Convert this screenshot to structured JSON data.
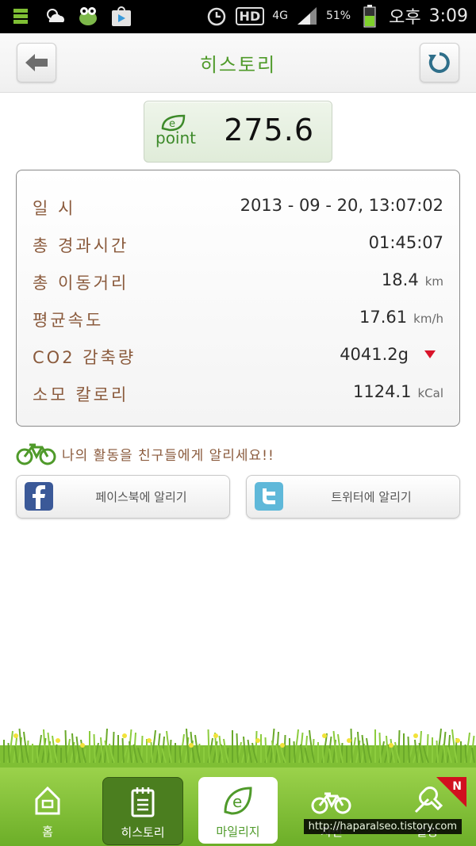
{
  "status_bar": {
    "battery_pct": "51%",
    "network": "4G",
    "hd": "HD",
    "ampm": "오후",
    "time": "3:09"
  },
  "header": {
    "title": "히스토리"
  },
  "epoint": {
    "logo_text": "point",
    "value": "275.6"
  },
  "details": [
    {
      "label": "일 시",
      "value": "2013 - 09 - 20, 13:07:02",
      "unit": ""
    },
    {
      "label": "총 경과시간",
      "value": "01:45:07",
      "unit": ""
    },
    {
      "label": "총 이동거리",
      "value": "18.4",
      "unit": "km"
    },
    {
      "label": "평균속도",
      "value": "17.61",
      "unit": "km/h"
    },
    {
      "label": "CO2 감축량",
      "value": "4041.2g",
      "unit": ""
    },
    {
      "label": "소모 칼로리",
      "value": "1124.1",
      "unit": "kCal"
    }
  ],
  "share": {
    "prompt": "나의 활동을 친구들에게 알리세요!!",
    "facebook_label": "페이스북에 알리기",
    "twitter_label": "트위터에 알리기"
  },
  "tabs": [
    {
      "label": "홈"
    },
    {
      "label": "히스토리"
    },
    {
      "label": "마일리지"
    },
    {
      "label": "자전"
    },
    {
      "label": "설정"
    }
  ],
  "badge": "N",
  "watermark": "http://haparalseo.tistory.com",
  "colors": {
    "accent_green": "#4f9a2a",
    "label_brown": "#8a5a3c",
    "tab_bar": "#7fbf34",
    "co2_marker": "#d9142a"
  }
}
